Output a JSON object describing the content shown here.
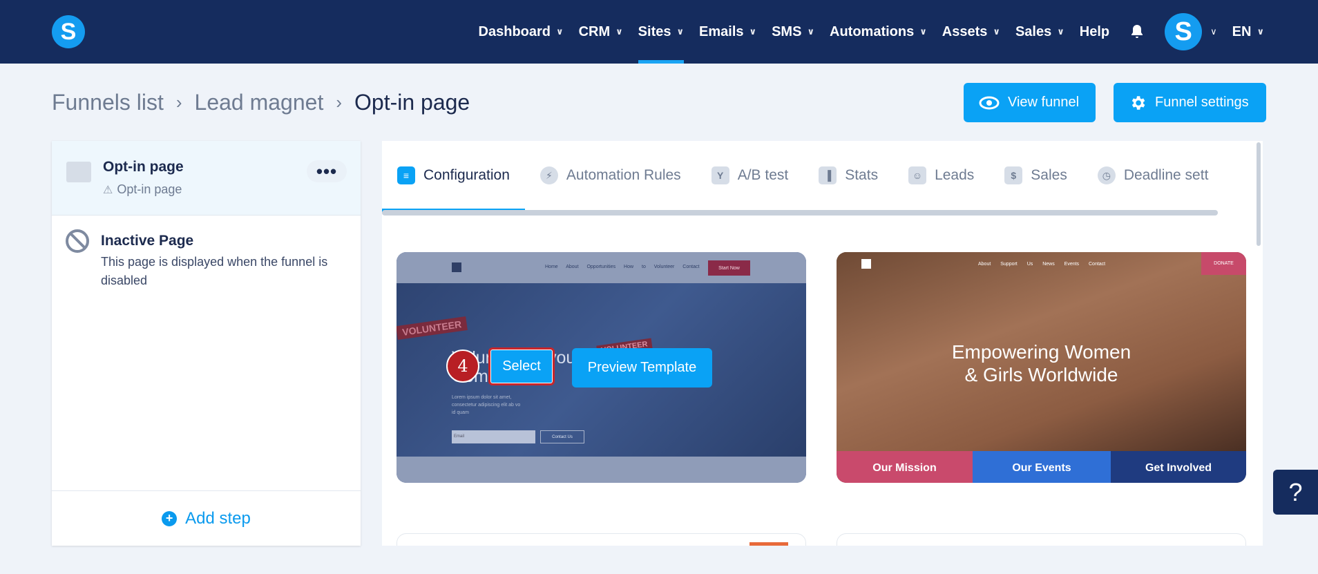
{
  "logo": {
    "letter": "S"
  },
  "nav": {
    "items": [
      {
        "label": "Dashboard",
        "dropdown": true
      },
      {
        "label": "CRM",
        "dropdown": true
      },
      {
        "label": "Sites",
        "dropdown": true,
        "active": true
      },
      {
        "label": "Emails",
        "dropdown": true
      },
      {
        "label": "SMS",
        "dropdown": true
      },
      {
        "label": "Automations",
        "dropdown": true
      },
      {
        "label": "Assets",
        "dropdown": true
      },
      {
        "label": "Sales",
        "dropdown": true
      },
      {
        "label": "Help",
        "dropdown": false
      }
    ],
    "avatar_letter": "S",
    "language": "EN"
  },
  "breadcrumb": {
    "items": [
      "Funnels list",
      "Lead magnet",
      "Opt-in page"
    ]
  },
  "actions": {
    "view_funnel": "View funnel",
    "funnel_settings": "Funnel settings"
  },
  "left_panel": {
    "active_step": {
      "title": "Opt-in page",
      "subtitle": "Opt-in page",
      "menu": "•••"
    },
    "inactive": {
      "title": "Inactive Page",
      "description": "This page is displayed when the funnel is disabled"
    },
    "add_step": "Add step"
  },
  "tabs": [
    {
      "label": "Configuration",
      "active": true
    },
    {
      "label": "Automation Rules"
    },
    {
      "label": "A/B test"
    },
    {
      "label": "Stats"
    },
    {
      "label": "Leads"
    },
    {
      "label": "Sales"
    },
    {
      "label": "Deadline sett"
    }
  ],
  "templates": {
    "card1": {
      "nav_links": "Home About Opportunities How to Volunteer Contact",
      "nav_cta": "Start Now",
      "stamp1": "VOLUNTEER",
      "stamp2": "VOLUNTEER",
      "heading": "Volunteer in your Community",
      "body": "Lorem ipsum dolor sit amet, consectetur adipiscing elit ab vo id quam",
      "email_placeholder": "Email",
      "contact_button": "Contact Us",
      "select_label": "Select",
      "preview_label": "Preview Template",
      "step_badge": "4"
    },
    "card2": {
      "nav_links": "About Support Us News Events Contact",
      "donate": "DONATE",
      "heading_line1": "Empowering Women",
      "heading_line2": "& Girls Worldwide",
      "strip": [
        {
          "label": "Our Mission",
          "color": "#c94a6c"
        },
        {
          "label": "Our Events",
          "color": "#2f6fd6"
        },
        {
          "label": "Get Involved",
          "color": "#1f3b80"
        }
      ]
    }
  },
  "help": {
    "label": "?"
  },
  "colors": {
    "brand": "#152c5e",
    "accent": "#0aa2f5",
    "badge": "#b81f24"
  }
}
